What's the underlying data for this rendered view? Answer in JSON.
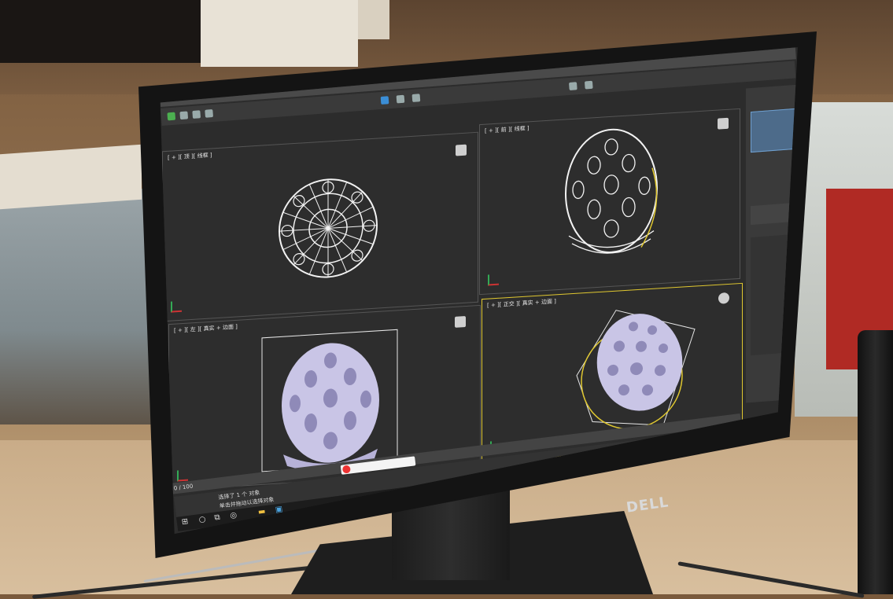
{
  "scene": {
    "monitor_brand": "DELL"
  },
  "app": {
    "viewports": [
      {
        "label": "[ + ][ 顶 ][ 线框 ]"
      },
      {
        "label": "[ + ][ 前 ][ 线框 ]"
      },
      {
        "label": "[ + ][ 左 ][ 真实 + 边面 ]"
      },
      {
        "label": "[ + ][ 正交 ][ 真实 + 边面 ]"
      }
    ],
    "status": {
      "line1": "选择了 1 个 对象",
      "line2": "单击并拖动以选择对象"
    },
    "timeline": {
      "frame": "0 / 100"
    }
  },
  "colors": {
    "viewport_bg": "#2d2d2d",
    "wireframe": "#f2f2f2",
    "shaded_model": "#c9c5e6",
    "active_border": "#e0c830"
  }
}
